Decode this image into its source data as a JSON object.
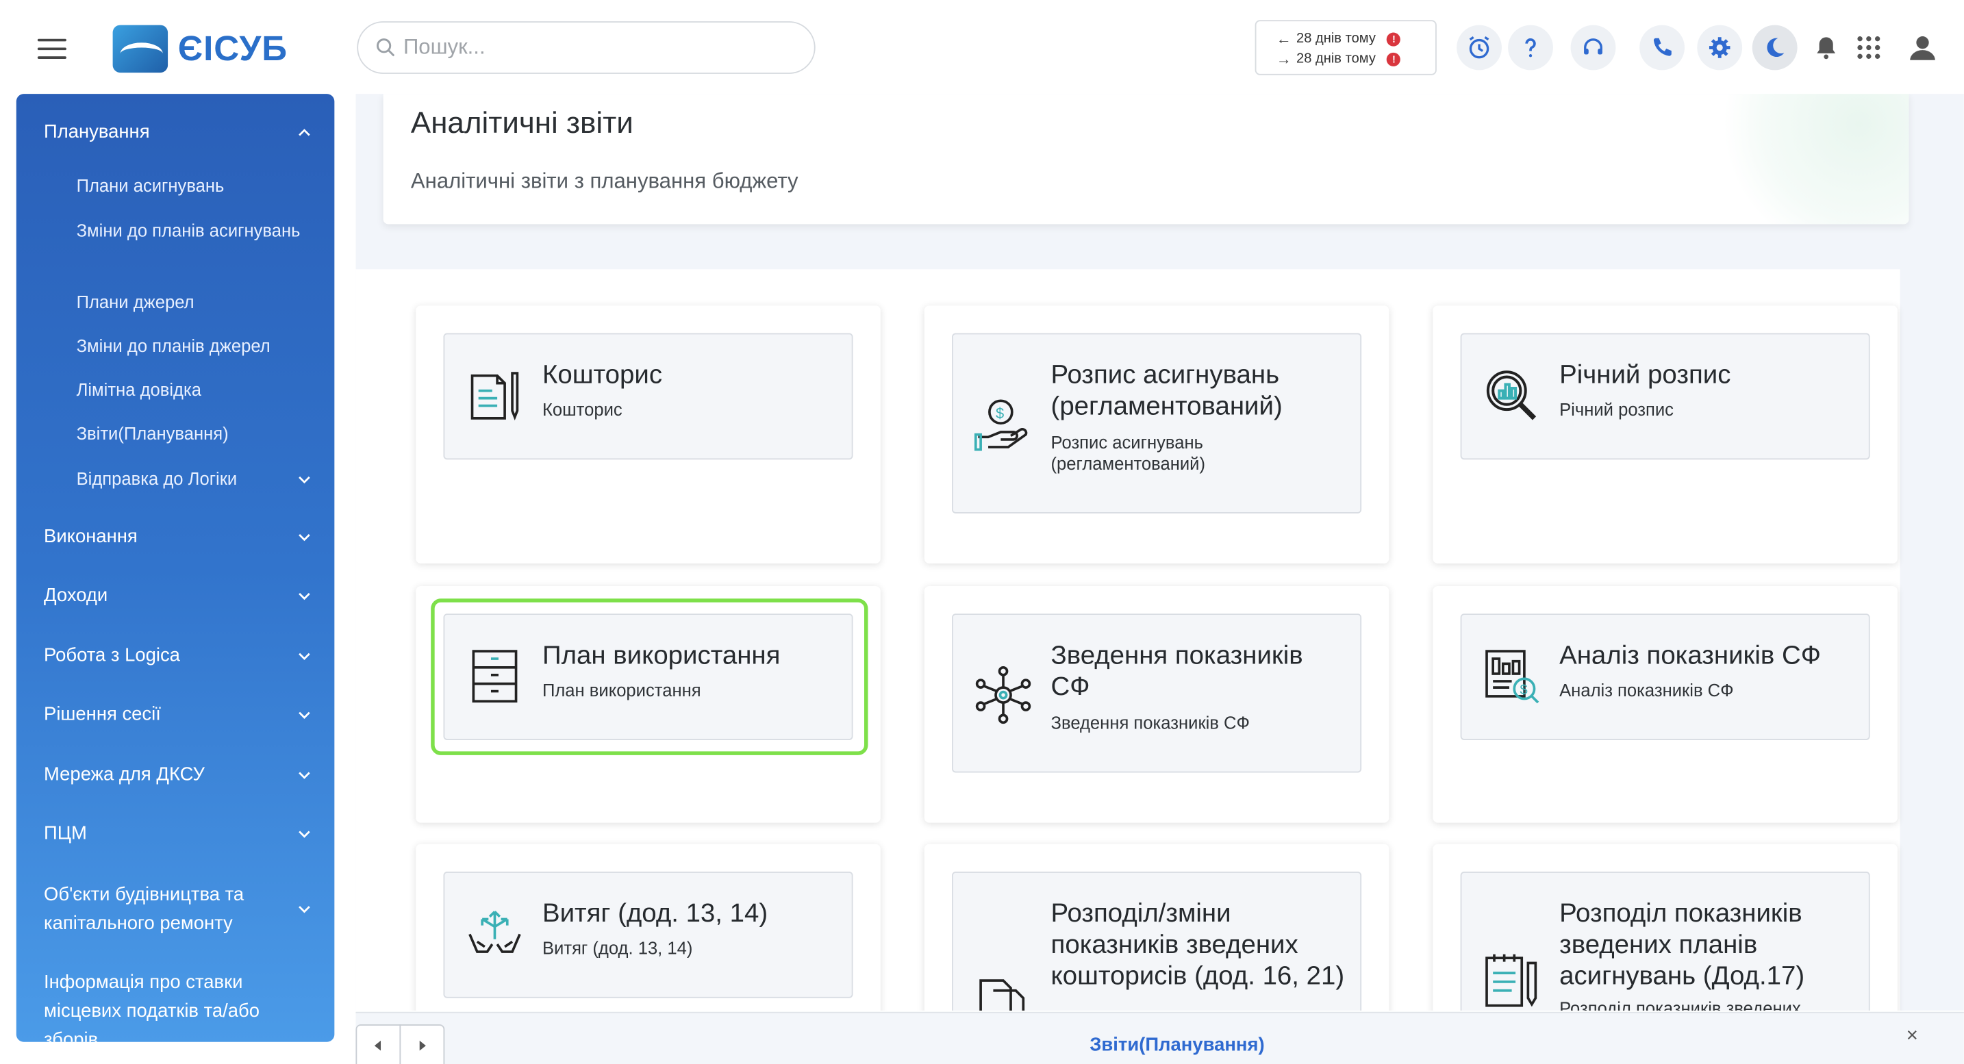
{
  "header": {
    "logo_text": "ЄІСУБ",
    "search_placeholder": "Пошук...",
    "sync": [
      {
        "arrow": "←",
        "text": "28 днів тому",
        "badge": "!"
      },
      {
        "arrow": "→",
        "text": "28 днів тому",
        "badge": "!"
      }
    ],
    "icons": [
      "alarm-clock-icon",
      "help-icon",
      "support-headset-icon",
      "phone-icon",
      "settings-gear-icon",
      "moon-icon",
      "bell-icon",
      "apps-grid-icon",
      "user-avatar-icon"
    ]
  },
  "sidebar": {
    "sections": [
      {
        "label": "Планування",
        "expanded": true
      },
      {
        "label": "Виконання"
      },
      {
        "label": "Доходи"
      },
      {
        "label": "Робота з Logica"
      },
      {
        "label": "Рішення сесії"
      },
      {
        "label": "Мережа для ДКСУ"
      },
      {
        "label": "ПЦМ"
      },
      {
        "label": "Об'єкти будівництва та капітального ремонту"
      },
      {
        "label": "Інформація про ставки місцевих податків та/або зборів"
      }
    ],
    "sub_items": [
      "Плани асигнувань",
      "Зміни до планів асигнувань",
      "Плани джерел",
      "Зміни до планів джерел",
      "Лімітна довідка",
      "Звіти(Планування)",
      "Відправка до Логіки"
    ]
  },
  "page": {
    "title": "Аналітичні звіти",
    "subtitle": "Аналітичні звіти з планування бюджету"
  },
  "cards": [
    {
      "title": "Кошторис",
      "subtitle": "Кошторис",
      "icon": "document-pencil-icon"
    },
    {
      "title": "Розпис асигнувань (регламентований)",
      "subtitle": "Розпис асигнувань (регламентований)",
      "icon": "hand-money-icon"
    },
    {
      "title": "Річний розпис",
      "subtitle": "Річний розпис",
      "icon": "magnifier-chart-icon"
    },
    {
      "title": "План використання",
      "subtitle": "План використання",
      "icon": "cabinet-icon",
      "selected": true
    },
    {
      "title": "Зведення показників СФ",
      "subtitle": "Зведення показників СФ",
      "icon": "network-nodes-icon"
    },
    {
      "title": "Аналіз показників СФ",
      "subtitle": "Аналіз показників СФ",
      "icon": "report-money-icon"
    },
    {
      "title": "Витяг (дод. 13, 14)",
      "subtitle": "Витяг (дод. 13, 14)",
      "icon": "hands-arrows-icon"
    },
    {
      "title": "Розподіл/зміни показників зведених кошторисів (дод. 16, 21)",
      "subtitle": "",
      "icon": "documents-icon"
    },
    {
      "title": "Розподіл показників зведених планів асигнувань (Дод.17)",
      "subtitle": "Розподіл показників зведених",
      "icon": "notepad-pen-icon"
    }
  ],
  "bottom_bar": {
    "active_tab": "Звіти(Планування)",
    "close": "×"
  },
  "colors": {
    "accent": "#2f6ad0",
    "sidebar_top": "#2a5fb8",
    "sidebar_bottom": "#4b9be8",
    "highlight": "#7ee04a",
    "alert": "#d9363e"
  }
}
